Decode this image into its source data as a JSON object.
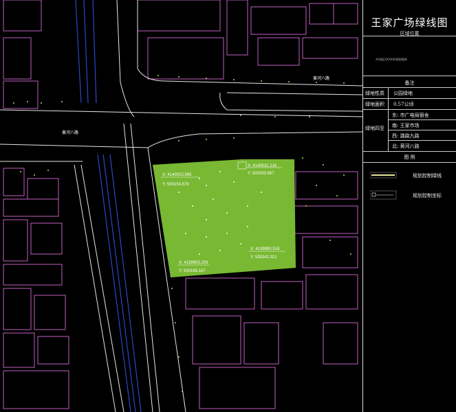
{
  "panel": {
    "title": "王家广场绿线图",
    "location_header": "区域位置",
    "location_note": "XX地区XXXXXX规划图例",
    "remarks_header": "备注",
    "rows": [
      {
        "label": "绿地性质",
        "value": "公园绿地"
      },
      {
        "label": "绿地面积",
        "value": "0.57公顷"
      }
    ],
    "bounds_label": "绿地四至",
    "bounds": [
      {
        "dir": "东:",
        "value": "市广电局宿舍"
      },
      {
        "dir": "南:",
        "value": "王家市场"
      },
      {
        "dir": "西:",
        "value": "潞路九路"
      },
      {
        "dir": "北:",
        "value": "黄河八路"
      }
    ],
    "legend_header": "图  例",
    "legend": [
      {
        "label": "规划控制绿线",
        "color": "#e8e8a0",
        "symbol": "line"
      },
      {
        "label": "规划控制坐标",
        "color": "#ffffff",
        "symbol": "coordinate-box"
      }
    ]
  },
  "map": {
    "green_fill": "#78b832",
    "street_labels": [
      "黄河八路",
      "黄河八路"
    ],
    "coordinates": [
      {
        "x": "X: 4140023.965",
        "y": "Y: 500154.679"
      },
      {
        "x": "X: 4140031.216",
        "y": "Y: 500333.567"
      },
      {
        "x": "X: 4139990.519",
        "y": "Y: 539242.321"
      },
      {
        "x": "X: 4139953.293",
        "y": "Y: 500165.167"
      }
    ]
  }
}
